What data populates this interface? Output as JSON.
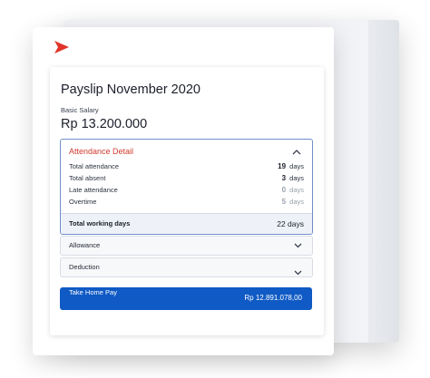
{
  "payslip": {
    "title": "Payslip November 2020",
    "basic_salary_label": "Basic Salary",
    "basic_salary_value": "Rp 13.200.000"
  },
  "attendance": {
    "header": "Attendance Detail",
    "rows": [
      {
        "label": "Total attendance",
        "value": "19",
        "unit": "days"
      },
      {
        "label": "Total absent",
        "value": "3",
        "unit": "days"
      },
      {
        "label": "Late attendance",
        "value": "0",
        "unit": "days"
      },
      {
        "label": "Overtime",
        "value": "5",
        "unit": "days"
      }
    ],
    "total_label": "Total working days",
    "total_value": "22 days"
  },
  "allowance": {
    "label": "Allowance"
  },
  "deduction": {
    "label": "Deduction"
  },
  "take_home": {
    "label": "Take Home Pay",
    "value": "Rp 12.891.078,00"
  },
  "colors": {
    "accent_blue": "#0f5ac4",
    "attendance_header_red": "#d23b2f",
    "logo_red": "#e0342a"
  },
  "icons": [
    "logo-icon",
    "chevron-up-icon",
    "chevron-down-icon"
  ]
}
